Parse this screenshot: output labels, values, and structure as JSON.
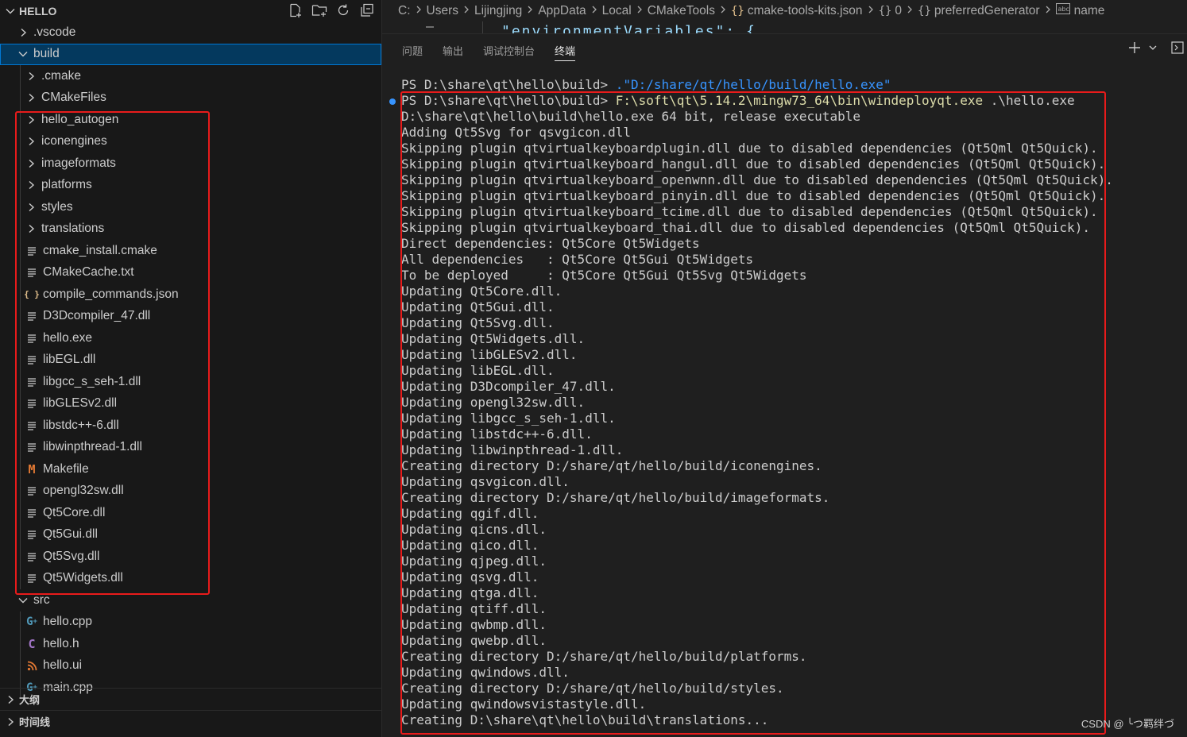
{
  "explorer": {
    "title": "HELLO",
    "items": [
      {
        "label": ".vscode",
        "type": "folder",
        "depth": 1,
        "expanded": false
      },
      {
        "label": "build",
        "type": "folder",
        "depth": 1,
        "expanded": true,
        "selected": true
      },
      {
        "label": ".cmake",
        "type": "folder",
        "depth": 2,
        "expanded": false
      },
      {
        "label": "CMakeFiles",
        "type": "folder",
        "depth": 2,
        "expanded": false
      },
      {
        "label": "hello_autogen",
        "type": "folder",
        "depth": 2,
        "expanded": false
      },
      {
        "label": "iconengines",
        "type": "folder",
        "depth": 2,
        "expanded": false
      },
      {
        "label": "imageformats",
        "type": "folder",
        "depth": 2,
        "expanded": false
      },
      {
        "label": "platforms",
        "type": "folder",
        "depth": 2,
        "expanded": false
      },
      {
        "label": "styles",
        "type": "folder",
        "depth": 2,
        "expanded": false
      },
      {
        "label": "translations",
        "type": "folder",
        "depth": 2,
        "expanded": false
      },
      {
        "label": "cmake_install.cmake",
        "type": "file",
        "icon": "lines",
        "depth": 2
      },
      {
        "label": "CMakeCache.txt",
        "type": "file",
        "icon": "lines",
        "depth": 2
      },
      {
        "label": "compile_commands.json",
        "type": "file",
        "icon": "json",
        "depth": 2
      },
      {
        "label": "D3Dcompiler_47.dll",
        "type": "file",
        "icon": "lines",
        "depth": 2
      },
      {
        "label": "hello.exe",
        "type": "file",
        "icon": "lines",
        "depth": 2
      },
      {
        "label": "libEGL.dll",
        "type": "file",
        "icon": "lines",
        "depth": 2
      },
      {
        "label": "libgcc_s_seh-1.dll",
        "type": "file",
        "icon": "lines",
        "depth": 2
      },
      {
        "label": "libGLESv2.dll",
        "type": "file",
        "icon": "lines",
        "depth": 2
      },
      {
        "label": "libstdc++-6.dll",
        "type": "file",
        "icon": "lines",
        "depth": 2
      },
      {
        "label": "libwinpthread-1.dll",
        "type": "file",
        "icon": "lines",
        "depth": 2
      },
      {
        "label": "Makefile",
        "type": "file",
        "icon": "makefile",
        "depth": 2
      },
      {
        "label": "opengl32sw.dll",
        "type": "file",
        "icon": "lines",
        "depth": 2
      },
      {
        "label": "Qt5Core.dll",
        "type": "file",
        "icon": "lines",
        "depth": 2
      },
      {
        "label": "Qt5Gui.dll",
        "type": "file",
        "icon": "lines",
        "depth": 2
      },
      {
        "label": "Qt5Svg.dll",
        "type": "file",
        "icon": "lines",
        "depth": 2
      },
      {
        "label": "Qt5Widgets.dll",
        "type": "file",
        "icon": "lines",
        "depth": 2
      },
      {
        "label": "src",
        "type": "folder",
        "depth": 1,
        "expanded": true
      },
      {
        "label": "hello.cpp",
        "type": "file",
        "icon": "cpp",
        "depth": 2
      },
      {
        "label": "hello.h",
        "type": "file",
        "icon": "h",
        "depth": 2
      },
      {
        "label": "hello.ui",
        "type": "file",
        "icon": "rss",
        "depth": 2
      },
      {
        "label": "main.cpp",
        "type": "file",
        "icon": "cpp",
        "depth": 2
      }
    ]
  },
  "outline": {
    "label": "大纲"
  },
  "timeline": {
    "label": "时间线"
  },
  "breadcrumb": [
    {
      "label": "C:",
      "icon": ""
    },
    {
      "label": "Users",
      "icon": ""
    },
    {
      "label": "Lijingjing",
      "icon": ""
    },
    {
      "label": "AppData",
      "icon": ""
    },
    {
      "label": "Local",
      "icon": ""
    },
    {
      "label": "CMakeTools",
      "icon": ""
    },
    {
      "label": "cmake-tools-kits.json",
      "icon": "{}"
    },
    {
      "label": "0",
      "icon": "{}"
    },
    {
      "label": "preferredGenerator",
      "icon": "{}"
    },
    {
      "label": "name",
      "icon": "abc"
    }
  ],
  "editor_peek_text": "\"environmentVariables\": {",
  "panel": {
    "tabs": [
      "问题",
      "输出",
      "调试控制台",
      "终端"
    ],
    "active_tab": "终端"
  },
  "terminal": {
    "lines": [
      {
        "text": "PS D:\\share\\qt\\hello\\build> ",
        "cmd": ".\"D:/share/qt/hello/build/hello.exe\"",
        "cmd_color": "blue"
      },
      {
        "text": "PS D:\\share\\qt\\hello\\build> ",
        "cmd": "F:\\soft\\qt\\5.14.2\\mingw73_64\\bin\\windeployqt.exe",
        "rest": " .\\hello.exe",
        "cmd_color": "yellow"
      },
      {
        "text": "D:\\share\\qt\\hello\\build\\hello.exe 64 bit, release executable"
      },
      {
        "text": "Adding Qt5Svg for qsvgicon.dll"
      },
      {
        "text": "Skipping plugin qtvirtualkeyboardplugin.dll due to disabled dependencies (Qt5Qml Qt5Quick)."
      },
      {
        "text": "Skipping plugin qtvirtualkeyboard_hangul.dll due to disabled dependencies (Qt5Qml Qt5Quick)."
      },
      {
        "text": "Skipping plugin qtvirtualkeyboard_openwnn.dll due to disabled dependencies (Qt5Qml Qt5Quick)."
      },
      {
        "text": "Skipping plugin qtvirtualkeyboard_pinyin.dll due to disabled dependencies (Qt5Qml Qt5Quick)."
      },
      {
        "text": "Skipping plugin qtvirtualkeyboard_tcime.dll due to disabled dependencies (Qt5Qml Qt5Quick)."
      },
      {
        "text": "Skipping plugin qtvirtualkeyboard_thai.dll due to disabled dependencies (Qt5Qml Qt5Quick)."
      },
      {
        "text": "Direct dependencies: Qt5Core Qt5Widgets"
      },
      {
        "text": "All dependencies   : Qt5Core Qt5Gui Qt5Widgets"
      },
      {
        "text": "To be deployed     : Qt5Core Qt5Gui Qt5Svg Qt5Widgets"
      },
      {
        "text": "Updating Qt5Core.dll."
      },
      {
        "text": "Updating Qt5Gui.dll."
      },
      {
        "text": "Updating Qt5Svg.dll."
      },
      {
        "text": "Updating Qt5Widgets.dll."
      },
      {
        "text": "Updating libGLESv2.dll."
      },
      {
        "text": "Updating libEGL.dll."
      },
      {
        "text": "Updating D3Dcompiler_47.dll."
      },
      {
        "text": "Updating opengl32sw.dll."
      },
      {
        "text": "Updating libgcc_s_seh-1.dll."
      },
      {
        "text": "Updating libstdc++-6.dll."
      },
      {
        "text": "Updating libwinpthread-1.dll."
      },
      {
        "text": "Creating directory D:/share/qt/hello/build/iconengines."
      },
      {
        "text": "Updating qsvgicon.dll."
      },
      {
        "text": "Creating directory D:/share/qt/hello/build/imageformats."
      },
      {
        "text": "Updating qgif.dll."
      },
      {
        "text": "Updating qicns.dll."
      },
      {
        "text": "Updating qico.dll."
      },
      {
        "text": "Updating qjpeg.dll."
      },
      {
        "text": "Updating qsvg.dll."
      },
      {
        "text": "Updating qtga.dll."
      },
      {
        "text": "Updating qtiff.dll."
      },
      {
        "text": "Updating qwbmp.dll."
      },
      {
        "text": "Updating qwebp.dll."
      },
      {
        "text": "Creating directory D:/share/qt/hello/build/platforms."
      },
      {
        "text": "Updating qwindows.dll."
      },
      {
        "text": "Creating directory D:/share/qt/hello/build/styles."
      },
      {
        "text": "Updating qwindowsvistastyle.dll."
      },
      {
        "text": "Creating D:\\share\\qt\\hello\\build\\translations..."
      }
    ]
  },
  "watermark": "CSDN @ ╰つ羁绊づ",
  "colors": {
    "highlight_box": "#e81b1b",
    "selection": "#04395e",
    "terminal_command": "#dcdcaa",
    "terminal_string": "#3794ff",
    "json_icon": "#e2c08d",
    "makefile_icon": "#e37933",
    "cpp_icon": "#519aba",
    "h_icon": "#a074c4"
  }
}
